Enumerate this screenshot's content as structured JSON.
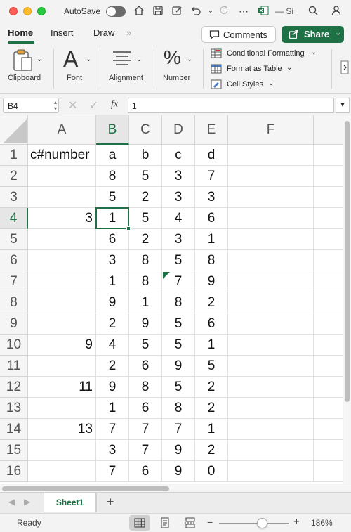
{
  "titlebar": {
    "autosave_label": "AutoSave",
    "title": "— Si",
    "icons": [
      "home-icon",
      "save-icon",
      "pen-icon",
      "undo-icon",
      "redo-icon",
      "more-icon",
      "excel-icon",
      "search-icon",
      "person-icon"
    ]
  },
  "ribbon_tabs": {
    "home": "Home",
    "insert": "Insert",
    "draw": "Draw",
    "more": "»"
  },
  "buttons": {
    "comments": "Comments",
    "share": "Share"
  },
  "ribbon": {
    "clipboard": "Clipboard",
    "font": "Font",
    "alignment": "Alignment",
    "number": "Number",
    "conditional_formatting": "Conditional Formatting",
    "format_as_table": "Format as Table",
    "cell_styles": "Cell Styles"
  },
  "formula_bar": {
    "name_box": "B4",
    "fx": "fx",
    "value": "1"
  },
  "columns": [
    "A",
    "B",
    "C",
    "D",
    "E",
    "F"
  ],
  "selected_column": "B",
  "selected_row": "4",
  "rows": [
    {
      "num": "1",
      "A": "c#number",
      "B": "a",
      "C": "b",
      "D": "c",
      "E": "d"
    },
    {
      "num": "2",
      "A": "",
      "B": "8",
      "C": "5",
      "D": "3",
      "E": "7"
    },
    {
      "num": "3",
      "A": "",
      "B": "5",
      "C": "2",
      "D": "3",
      "E": "3"
    },
    {
      "num": "4",
      "A": "3",
      "B": "1",
      "C": "5",
      "D": "4",
      "E": "6"
    },
    {
      "num": "5",
      "A": "",
      "B": "6",
      "C": "2",
      "D": "3",
      "E": "1"
    },
    {
      "num": "6",
      "A": "",
      "B": "3",
      "C": "8",
      "D": "5",
      "E": "8"
    },
    {
      "num": "7",
      "A": "",
      "B": "1",
      "C": "8",
      "D": "7",
      "E": "9"
    },
    {
      "num": "8",
      "A": "",
      "B": "9",
      "C": "1",
      "D": "8",
      "E": "2"
    },
    {
      "num": "9",
      "A": "",
      "B": "2",
      "C": "9",
      "D": "5",
      "E": "6"
    },
    {
      "num": "10",
      "A": "9",
      "B": "4",
      "C": "5",
      "D": "5",
      "E": "1"
    },
    {
      "num": "11",
      "A": "",
      "B": "2",
      "C": "6",
      "D": "9",
      "E": "5"
    },
    {
      "num": "12",
      "A": "11",
      "B": "9",
      "C": "8",
      "D": "5",
      "E": "2"
    },
    {
      "num": "13",
      "A": "",
      "B": "1",
      "C": "6",
      "D": "8",
      "E": "2"
    },
    {
      "num": "14",
      "A": "13",
      "B": "7",
      "C": "7",
      "D": "7",
      "E": "1"
    },
    {
      "num": "15",
      "A": "",
      "B": "3",
      "C": "7",
      "D": "9",
      "E": "2"
    },
    {
      "num": "16",
      "A": "",
      "B": "7",
      "C": "6",
      "D": "9",
      "E": "0"
    }
  ],
  "sheet_tabs": {
    "active": "Sheet1",
    "add": "+"
  },
  "statusbar": {
    "ready": "Ready",
    "zoom": "186%",
    "minus": "−",
    "plus": "+"
  },
  "colors": {
    "accent": "#1e7145"
  }
}
